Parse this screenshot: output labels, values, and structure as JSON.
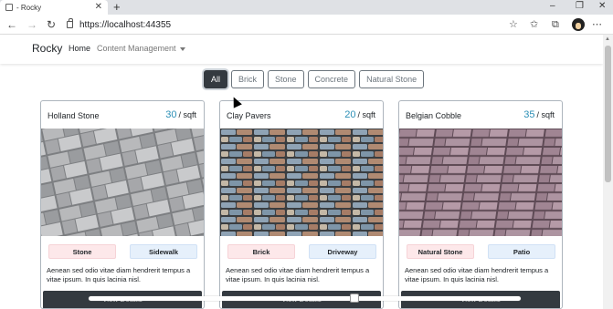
{
  "browser": {
    "tab_title": "- Rocky",
    "tab_close": "✕",
    "new_tab": "+",
    "url": "https://localhost:44355",
    "window_controls": [
      "‒",
      "❐",
      "✕"
    ]
  },
  "navbar": {
    "brand": "Rocky",
    "links": [
      {
        "label": "Home"
      },
      {
        "label": "Content Management"
      }
    ]
  },
  "filters": [
    {
      "label": "All",
      "active": true
    },
    {
      "label": "Brick",
      "active": false
    },
    {
      "label": "Stone",
      "active": false
    },
    {
      "label": "Concrete",
      "active": false
    },
    {
      "label": "Natural Stone",
      "active": false
    }
  ],
  "products": [
    {
      "name": "Holland Stone",
      "price": "30",
      "unit": "/ sqft",
      "category": "Stone",
      "application": "Sidewalk",
      "description": "Aenean sed odio vitae diam hendrerit tempus a vitae ipsum. In quis lacinia nisl.",
      "button": "View Details",
      "image_theme": "grey-pavers"
    },
    {
      "name": "Clay Pavers",
      "price": "20",
      "unit": "/ sqft",
      "category": "Brick",
      "application": "Driveway",
      "description": "Aenean sed odio vitae diam hendrerit tempus a vitae ipsum. In quis lacinia nisl.",
      "button": "View Details",
      "image_theme": "stone-wall"
    },
    {
      "name": "Belgian Cobble",
      "price": "35",
      "unit": "/ sqft",
      "category": "Natural Stone",
      "application": "Patio",
      "description": "Aenean sed odio vitae diam hendrerit tempus a vitae ipsum. In quis lacinia nisl.",
      "button": "View Details",
      "image_theme": "mauve-cobble"
    }
  ],
  "colors": {
    "accent_price": "#2c8fb6",
    "dark_button": "#343a40"
  }
}
